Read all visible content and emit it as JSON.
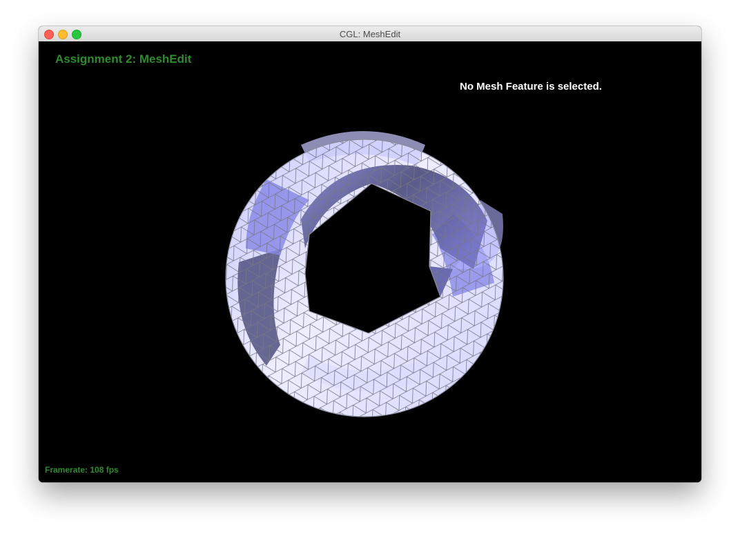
{
  "window": {
    "title": "CGL: MeshEdit"
  },
  "hud": {
    "assignment_title": "Assignment 2: MeshEdit",
    "status": "No Mesh Feature is selected.",
    "framerate": "Framerate: 108 fps"
  },
  "colors": {
    "hud_green": "#2e8b2e",
    "mesh_light": "#f4f4ff",
    "mesh_mid": "#aaaaff",
    "mesh_dark": "#505088",
    "wire": "#7a7a8a"
  },
  "icons": [
    "close-icon",
    "minimize-icon",
    "zoom-icon"
  ]
}
